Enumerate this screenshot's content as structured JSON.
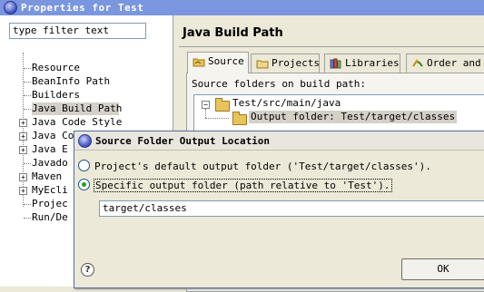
{
  "window": {
    "title": "Properties for Test",
    "app_icon": "eclipse-icon"
  },
  "filter": {
    "value": "type filter text"
  },
  "nav_tree": [
    {
      "label": "Resource",
      "expandable": false,
      "selected": false
    },
    {
      "label": "BeanInfo Path",
      "expandable": false,
      "selected": false
    },
    {
      "label": "Builders",
      "expandable": false,
      "selected": false
    },
    {
      "label": "Java Build Path",
      "expandable": false,
      "selected": true
    },
    {
      "label": "Java Code Style",
      "expandable": true,
      "selected": false
    },
    {
      "label": "Java Compiler",
      "expandable": true,
      "selected": false
    },
    {
      "label": "Java E",
      "expandable": true,
      "selected": false
    },
    {
      "label": "Javado",
      "expandable": false,
      "selected": false
    },
    {
      "label": "Maven",
      "expandable": true,
      "selected": false
    },
    {
      "label": "MyEcli",
      "expandable": true,
      "selected": false
    },
    {
      "label": "Projec",
      "expandable": false,
      "selected": false
    },
    {
      "label": "Run/De",
      "expandable": false,
      "selected": false
    }
  ],
  "page": {
    "title": "Java Build Path"
  },
  "tabs": [
    {
      "label": "Source",
      "icon": "source-folder-icon",
      "active": true
    },
    {
      "label": "Projects",
      "icon": "projects-icon",
      "active": false
    },
    {
      "label": "Libraries",
      "icon": "libraries-icon",
      "active": false
    },
    {
      "label": "Order and E",
      "icon": "order-export-icon",
      "active": false
    }
  ],
  "source": {
    "label": "Source folders on build path:",
    "folder": "Test/src/main/java",
    "output_folder": "Output folder: Test/target/classes"
  },
  "dialog": {
    "title": "Source Folder Output Location",
    "option_default": "Project's default output folder ('Test/target/classes').",
    "option_specific": "Specific output folder (path relative to 'Test').",
    "selected_option": "specific",
    "path_value": "target/classes",
    "ok_label": "OK",
    "help_glyph": "?"
  },
  "colors": {
    "title_bar": "#7a96df",
    "selection": "#d4d0c8",
    "radio_dot": "#21a121"
  }
}
